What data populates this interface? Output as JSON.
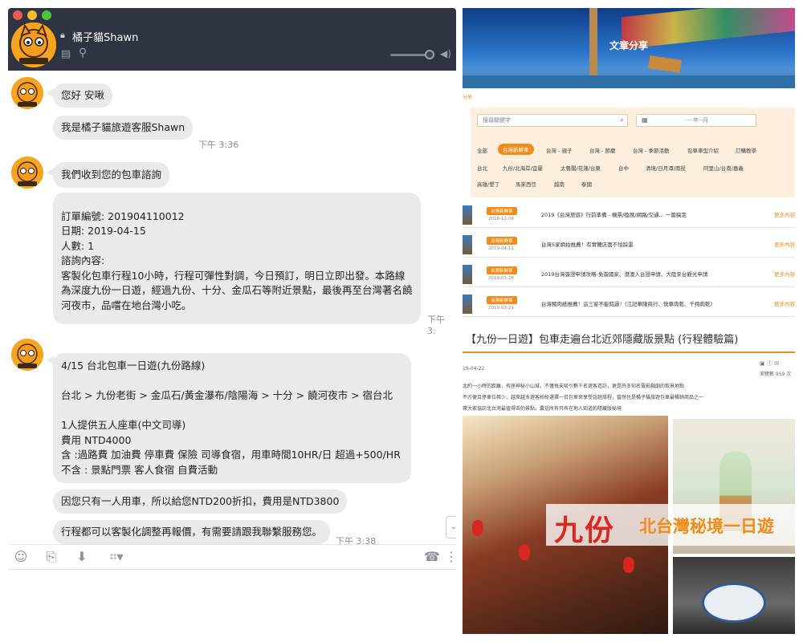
{
  "chat": {
    "contact_name": "橘子貓Shawn",
    "messages": [
      {
        "text": "您好 安啾"
      },
      {
        "text": "我是橘子貓旅遊客服Shawn",
        "time": "下午 3:36"
      },
      {
        "text": "我們收到您的包車諮詢"
      },
      {
        "text": "\n訂單編號: 201904110012\n日期: 2019-04-15\n人數: 1\n諮詢內容:\n客製化包車行程10小時，行程可彈性對調，今日預訂，明日立即出發。本路線\n為深度九份一日遊，經過九份、十分、金瓜石等附近景點，最後再至台灣著名饒\n河夜市，品嚐在地台灣小吃。",
        "time": "下午 3:"
      },
      {
        "text": "4/15 台北包車一日遊(九份路線)\n\n台北 > 九份老街 > 金瓜石/黃金瀑布/陰陽海 > 十分 > 饒河夜市 > 宿台北\n\n1人提供五人座車(中文司導)\n費用 NTD4000\n含 :過路費 加油費 停車費 保險 司導食宿，用車時間10HR/日 超過+500/HR\n不含 : 景點門票 客人食宿 自費活動"
      },
      {
        "text": "因您只有一人用車，所以給您NTD200折扣，費用是NTD3800"
      },
      {
        "text": "行程都可以客製化調整再報價，有需要請跟我聯繫服務您。",
        "time": "下午 3:38"
      }
    ],
    "icons": {
      "lock": "lock-icon",
      "notes": "notes-icon",
      "search": "search-icon",
      "speaker": "speaker-icon",
      "emoji": "emoji-icon",
      "attach": "paperclip-icon",
      "download": "download-icon",
      "crop": "crop-icon",
      "phone": "phone-icon"
    }
  },
  "blog": {
    "hero_title": "文章分享",
    "breadcrumb": "分享",
    "search_placeholder": "搜尋關鍵字",
    "date_placeholder": "----年--月",
    "categories_row1": [
      "全部",
      "台灣新鮮事",
      "台灣 - 親子",
      "台灣 - 節慶",
      "台灣 - 季節活動",
      "包車車型介紹",
      "訂購教學"
    ],
    "categories_row2": [
      "台北",
      "九份/北海岸/宜蘭",
      "太魯閣/花蓮/台東",
      "台中",
      "清境/日月潭/南投",
      "阿里山/台南/嘉義"
    ],
    "categories_row3": [
      "高雄/墾丁",
      "馬來西亞",
      "越南",
      "泰國"
    ],
    "articles": [
      {
        "tag": "台灣新鮮事",
        "date": "2018-12-06",
        "title": "2019《台灣旅遊》行前準備 - 機票/換匯/網路/交通... 一篇搞定",
        "more": "更多內容"
      },
      {
        "tag": "台灣新鮮事",
        "date": "2019-04-11",
        "title": "台灣5家網拍推薦！有實體店面不怕踩雷",
        "more": "更多內容"
      },
      {
        "tag": "台灣新鮮事",
        "date": "2019-03-28",
        "title": "2019台灣簽證申請攻略-免簽國家、港澳入台證申請、大陸來台觀光申請",
        "more": "更多內容"
      },
      {
        "tag": "台灣新鮮事",
        "date": "2019-03-21",
        "title": "台灣豬肉紙推薦！這三家不能錯過！(江記華隆商行、快車肉乾、千翔肉乾)",
        "more": "更多內容"
      }
    ],
    "post": {
      "title": "【九份一日遊】包車走遍台北近郊隱藏版景點 (行程體驗篇)",
      "date": "19-04-22",
      "views": "瀏覽數 959 次",
      "lines": [
        "北約一小時的距離，有座神秘小山城，不僅每天吸引數千名遊客造訪，更是許多知名電影戲劇的取景地點",
        "不方便且停車位稀少，越來越多遊客紛紛選擇一日包車來享受這趟旅程，當然也是橘子貓旅遊包車最暢銷商品之一",
        "帶大家協訪北台灣最值得去的景點，囊括所有只有在地人知道的隱藏版秘境"
      ],
      "banner_main": "九份",
      "banner_sub": "北台灣秘境一日遊"
    }
  },
  "colors": {
    "accent": "#f08c1a",
    "chat_header": "#2f3443",
    "bubble": "#e9eaec",
    "banner_red": "#d8271f"
  }
}
